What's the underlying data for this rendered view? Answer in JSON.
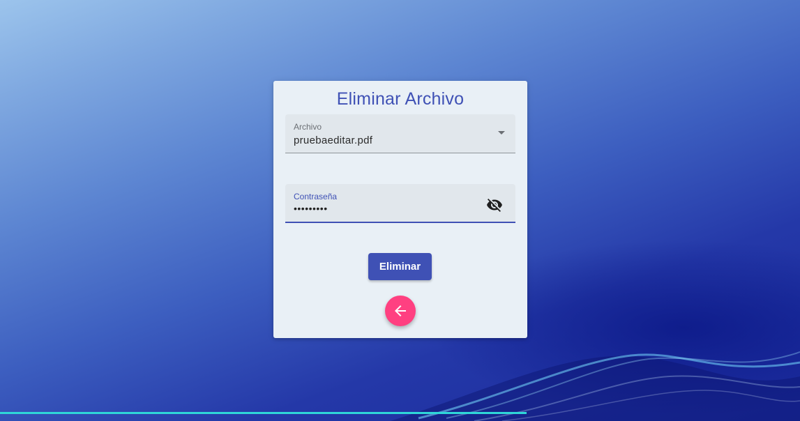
{
  "form": {
    "title": "Eliminar Archivo",
    "archivo": {
      "label": "Archivo",
      "value": "pruebaeditar.pdf"
    },
    "password": {
      "label": "Contraseña",
      "value": "•••••••••"
    },
    "submit_label": "Eliminar"
  },
  "icons": {
    "dropdown": "chevron-down-icon",
    "visibility": "eye-off-icon",
    "back": "arrow-left-icon"
  },
  "colors": {
    "primary": "#3f51b5",
    "accent": "#ff4081",
    "card": "#e9f0f6"
  }
}
